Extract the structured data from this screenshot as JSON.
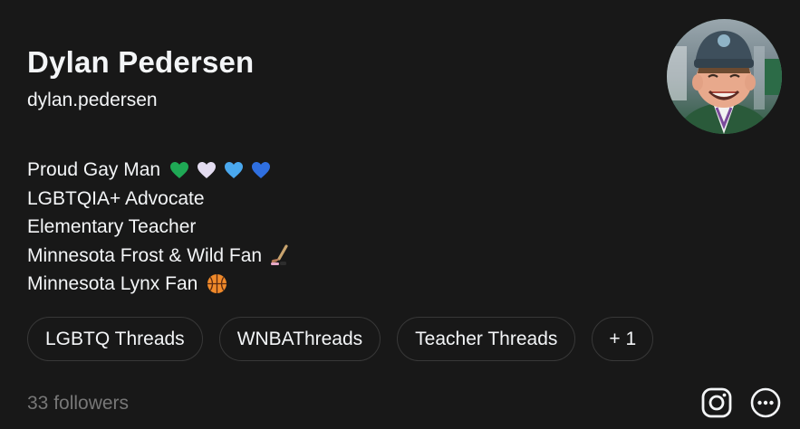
{
  "profile": {
    "name": "Dylan Pedersen",
    "username": "dylan.pedersen",
    "bio": [
      {
        "text": "Proud Gay Man",
        "emoji": [
          "green-heart",
          "white-heart",
          "light-blue-heart",
          "blue-heart"
        ]
      },
      {
        "text": "LGBTQIA+ Advocate",
        "emoji": []
      },
      {
        "text": "Elementary Teacher",
        "emoji": []
      },
      {
        "text": "Minnesota Frost & Wild Fan",
        "emoji": [
          "hockey-stick"
        ]
      },
      {
        "text": "Minnesota Lynx Fan",
        "emoji": [
          "basketball"
        ]
      }
    ],
    "tags": [
      "LGBTQ Threads",
      "WNBAThreads",
      "Teacher Threads",
      "+ 1"
    ],
    "followers": "33 followers"
  },
  "actions": {
    "instagram_icon": "instagram-icon",
    "more_icon": "more-options-icon"
  },
  "colors": {
    "background": "#181818",
    "text": "#f3f5f7",
    "muted": "#777777",
    "border": "#383838"
  }
}
